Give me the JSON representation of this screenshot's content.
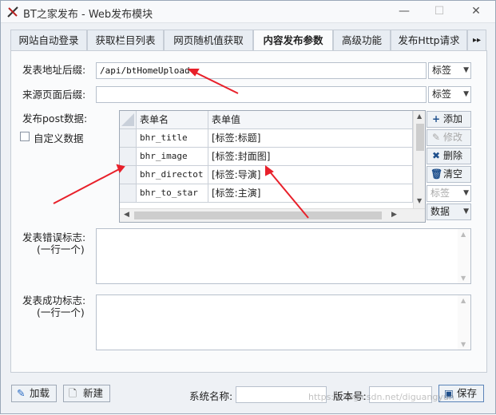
{
  "window": {
    "title": "BT之家发布 - Web发布模块",
    "minimize": "—",
    "maximize": "☐",
    "close": "✕"
  },
  "tabs": [
    {
      "label": "网站自动登录"
    },
    {
      "label": "获取栏目列表"
    },
    {
      "label": "网页随机值获取"
    },
    {
      "label": "内容发布参数"
    },
    {
      "label": "高级功能"
    },
    {
      "label": "发布Http请求"
    }
  ],
  "tabs_more": "▸▸",
  "form": {
    "post_url_label": "发表地址后缀:",
    "post_url_value": "/api/btHomeUpload",
    "post_url_combo": "标签",
    "source_page_label": "来源页面后缀:",
    "source_page_value": "",
    "source_page_combo": "标签",
    "post_data_label": "发布post数据:",
    "custom_data_label": "自定义数据"
  },
  "grid": {
    "columns": [
      "表单名",
      "表单值"
    ],
    "rows": [
      {
        "name": "bhr_title",
        "value": "[标签:标题]"
      },
      {
        "name": "bhr_image",
        "value": "[标签:封面图]"
      },
      {
        "name": "bhr_directot",
        "value": "[标签:导演]"
      },
      {
        "name": "bhr_to_star",
        "value": "[标签:主演]"
      }
    ]
  },
  "grid_buttons": {
    "add": "添加",
    "edit": "修改",
    "delete": "删除",
    "clear": "清空",
    "tag_combo": "标签",
    "data_combo": "数据"
  },
  "error_flag": {
    "label": "发表错误标志:",
    "hint": "(一行一个)",
    "value": ""
  },
  "success_flag": {
    "label": "发表成功标志:",
    "hint": "(一行一个)",
    "value": ""
  },
  "bottom": {
    "load": "加载",
    "new": "新建",
    "system_name_label": "系统名称:",
    "system_name_value": "",
    "version_label": "版本号:",
    "version_value": "",
    "save": "保存",
    "watermark": "https://blog.csdn.net/diguangyun"
  },
  "colors": {
    "accent": "#2b6cc4",
    "annotation_arrow": "#e8202a"
  }
}
